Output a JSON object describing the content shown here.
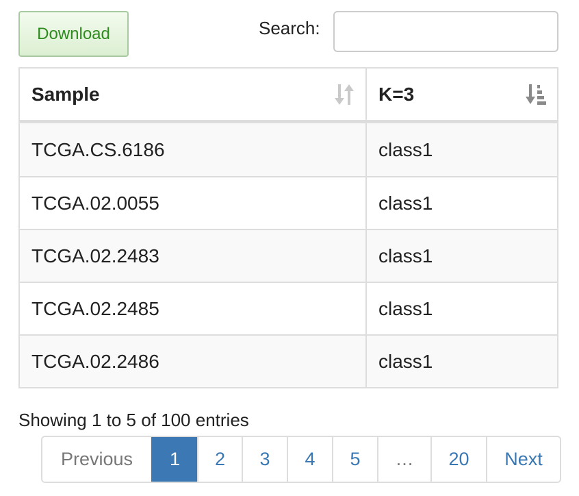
{
  "toolbar": {
    "download_label": "Download",
    "search_label": "Search:",
    "search_value": ""
  },
  "table": {
    "columns": [
      {
        "label": "Sample",
        "sort_state": "unsorted"
      },
      {
        "label": "K=3",
        "sort_state": "sorted-descending"
      }
    ],
    "rows": [
      {
        "sample": "TCGA.CS.6186",
        "k3": "class1"
      },
      {
        "sample": "TCGA.02.0055",
        "k3": "class1"
      },
      {
        "sample": "TCGA.02.2483",
        "k3": "class1"
      },
      {
        "sample": "TCGA.02.2485",
        "k3": "class1"
      },
      {
        "sample": "TCGA.02.2486",
        "k3": "class1"
      }
    ]
  },
  "info": "Showing 1 to 5 of 100 entries",
  "pagination": {
    "previous": "Previous",
    "pages": [
      "1",
      "2",
      "3",
      "4",
      "5",
      "…",
      "20"
    ],
    "next": "Next",
    "current": "1"
  },
  "colors": {
    "active_page": "#3c79b4",
    "link": "#3a78b3",
    "download_text": "#2f8a1f",
    "border": "#dddddd"
  }
}
